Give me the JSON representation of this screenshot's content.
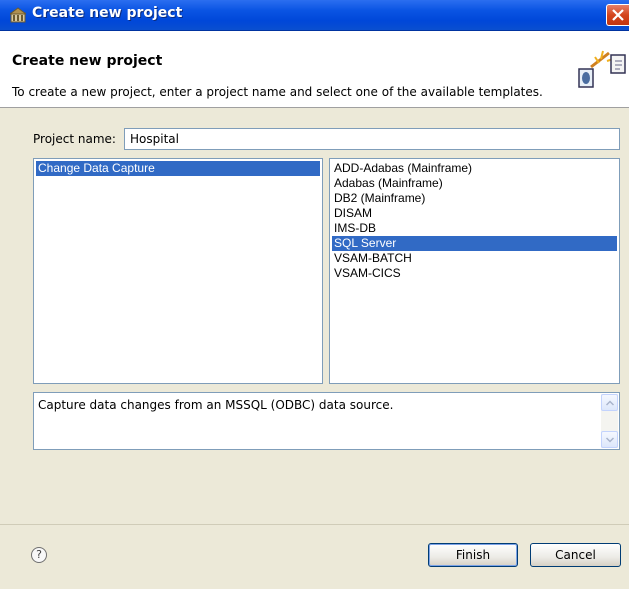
{
  "window": {
    "title": "Create new project"
  },
  "banner": {
    "heading": "Create new project",
    "description": "To create a new project, enter a project name and select one of the available templates."
  },
  "form": {
    "project_name_label": "Project name:",
    "project_name_value": "Hospital"
  },
  "categories": {
    "items": [
      "Change Data Capture"
    ],
    "selected_index": 0
  },
  "templates": {
    "items": [
      "ADD-Adabas (Mainframe)",
      "Adabas (Mainframe)",
      "DB2 (Mainframe)",
      "DISAM",
      "IMS-DB",
      "SQL Server",
      "VSAM-BATCH",
      "VSAM-CICS"
    ],
    "selected_index": 5
  },
  "template_description": "Capture data changes from an MSSQL (ODBC) data source.",
  "footer": {
    "help_glyph": "?",
    "finish_label": "Finish",
    "cancel_label": "Cancel"
  },
  "colors": {
    "titlebar": "#0a54e3",
    "selection": "#316ac5",
    "dialog_bg": "#ece9d8"
  }
}
